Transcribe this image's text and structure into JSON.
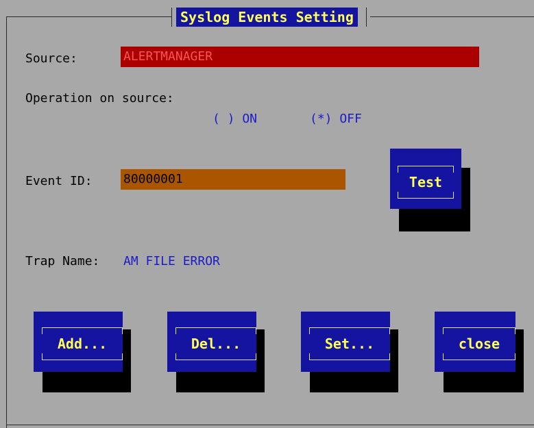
{
  "dialog": {
    "title": "Syslog Events Setting"
  },
  "source": {
    "label": "Source:",
    "value": "ALERTMANAGER"
  },
  "operation": {
    "label": "Operation on source:",
    "on_option": "( ) ON",
    "off_option": "(*) OFF",
    "selected": "OFF"
  },
  "event_id": {
    "label": "Event ID:",
    "value": "80000001"
  },
  "trap": {
    "label": "Trap Name:",
    "value": "AM FILE ERROR"
  },
  "buttons": {
    "test": "Test",
    "add": "Add...",
    "del": "Del...",
    "set": "Set...",
    "close": "close"
  },
  "colors": {
    "background": "#a8a8a8",
    "button_bg": "#1414a0",
    "button_text": "#ffff54",
    "source_field_bg": "#aa0000",
    "source_field_text": "#ff5454",
    "event_field_bg": "#aa5500",
    "event_field_text": "#000000",
    "option_text": "#1c1cc8"
  }
}
